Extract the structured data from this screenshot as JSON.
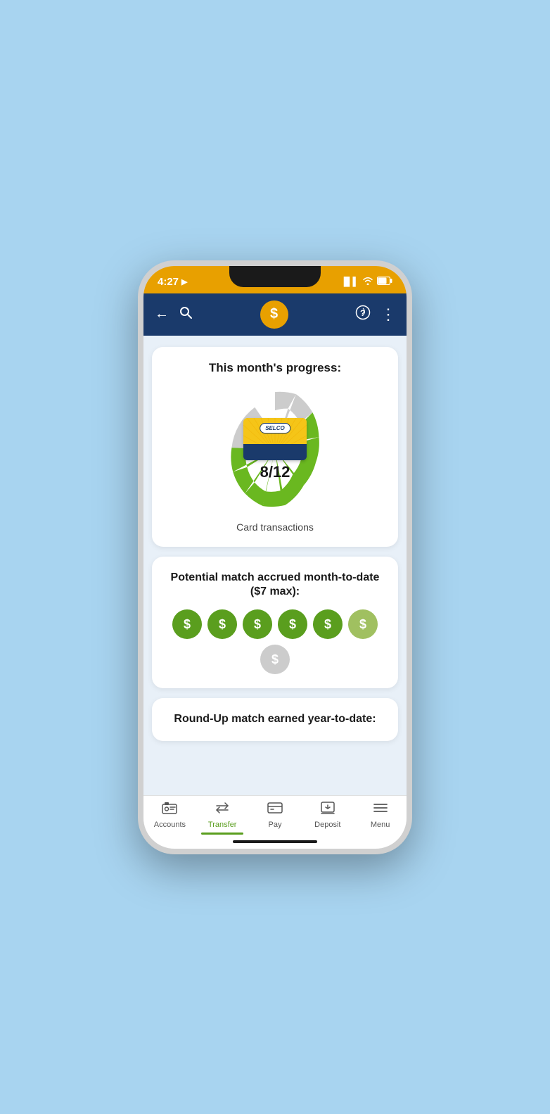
{
  "status_bar": {
    "time": "4:27",
    "location_icon": "▶",
    "signal": "▐▌▌",
    "wifi": "wifi",
    "battery": "battery"
  },
  "nav_bar": {
    "back_label": "←",
    "search_label": "🔍",
    "logo_symbol": "$",
    "help_label": "?",
    "more_label": "⋮"
  },
  "progress_card": {
    "title": "This month's progress:",
    "current": 8,
    "total": 12,
    "count_label": "8/12",
    "subtitle": "Card transactions",
    "filled_segments": 8,
    "total_segments": 12
  },
  "match_card": {
    "title": "Potential match accrued month-to-date ($7 max):",
    "icons": [
      {
        "state": "filled"
      },
      {
        "state": "filled"
      },
      {
        "state": "filled"
      },
      {
        "state": "filled"
      },
      {
        "state": "filled"
      },
      {
        "state": "half"
      },
      {
        "state": "empty"
      }
    ]
  },
  "roundup_card": {
    "title": "Round-Up match earned year-to-date:"
  },
  "bottom_nav": {
    "tabs": [
      {
        "id": "accounts",
        "label": "Accounts",
        "active": false
      },
      {
        "id": "transfer",
        "label": "Transfer",
        "active": true
      },
      {
        "id": "pay",
        "label": "Pay",
        "active": false
      },
      {
        "id": "deposit",
        "label": "Deposit",
        "active": false
      },
      {
        "id": "menu",
        "label": "Menu",
        "active": false
      }
    ]
  },
  "selco": {
    "name": "SELCO"
  }
}
